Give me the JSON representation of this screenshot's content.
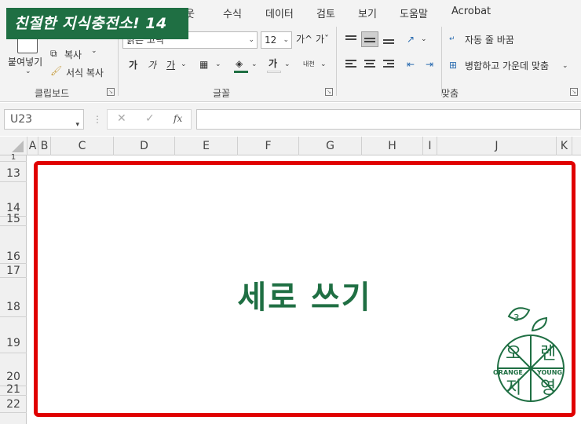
{
  "banner": {
    "text": "친절한 지식충전소! 14"
  },
  "tabs": [
    "웃",
    "수식",
    "데이터",
    "검토",
    "보기",
    "도움말",
    "Acrobat"
  ],
  "ribbon": {
    "clipboard": {
      "paste_label": "붙여넣기",
      "copy_label": "복사",
      "format_painter_label": "서식 복사",
      "group_label": "클립보드"
    },
    "font": {
      "font_name": "맑은 고딕",
      "font_size": "12",
      "grow_label": "가^",
      "shrink_label": "가ˇ",
      "bold_label": "가",
      "italic_label": "가",
      "underline_label": "가",
      "group_label": "글꼴",
      "phonetic_label": "내천"
    },
    "alignment": {
      "wrap_text_label": "자동 줄 바꿈",
      "merge_center_label": "병합하고 가운데 맞춤",
      "group_label": "맞춤"
    }
  },
  "formula_bar": {
    "name_box": "U23",
    "cancel": "✕",
    "enter": "✓",
    "fx": "fx",
    "formula": ""
  },
  "columns": [
    "A",
    "B",
    "C",
    "D",
    "E",
    "F",
    "G",
    "H",
    "I",
    "J",
    "K"
  ],
  "rows": [
    "1",
    "13",
    "14",
    "15",
    "16",
    "17",
    "18",
    "19",
    "20",
    "21",
    "22"
  ],
  "sheet_content": {
    "title": "세로 쓰기"
  },
  "logo": {
    "chars": [
      "오",
      "렌",
      "지",
      "영"
    ],
    "left_text": "ORANGE",
    "right_text": "YOUNG"
  },
  "colors": {
    "brand_green": "#1f6f43",
    "frame_red": "#e00000"
  }
}
